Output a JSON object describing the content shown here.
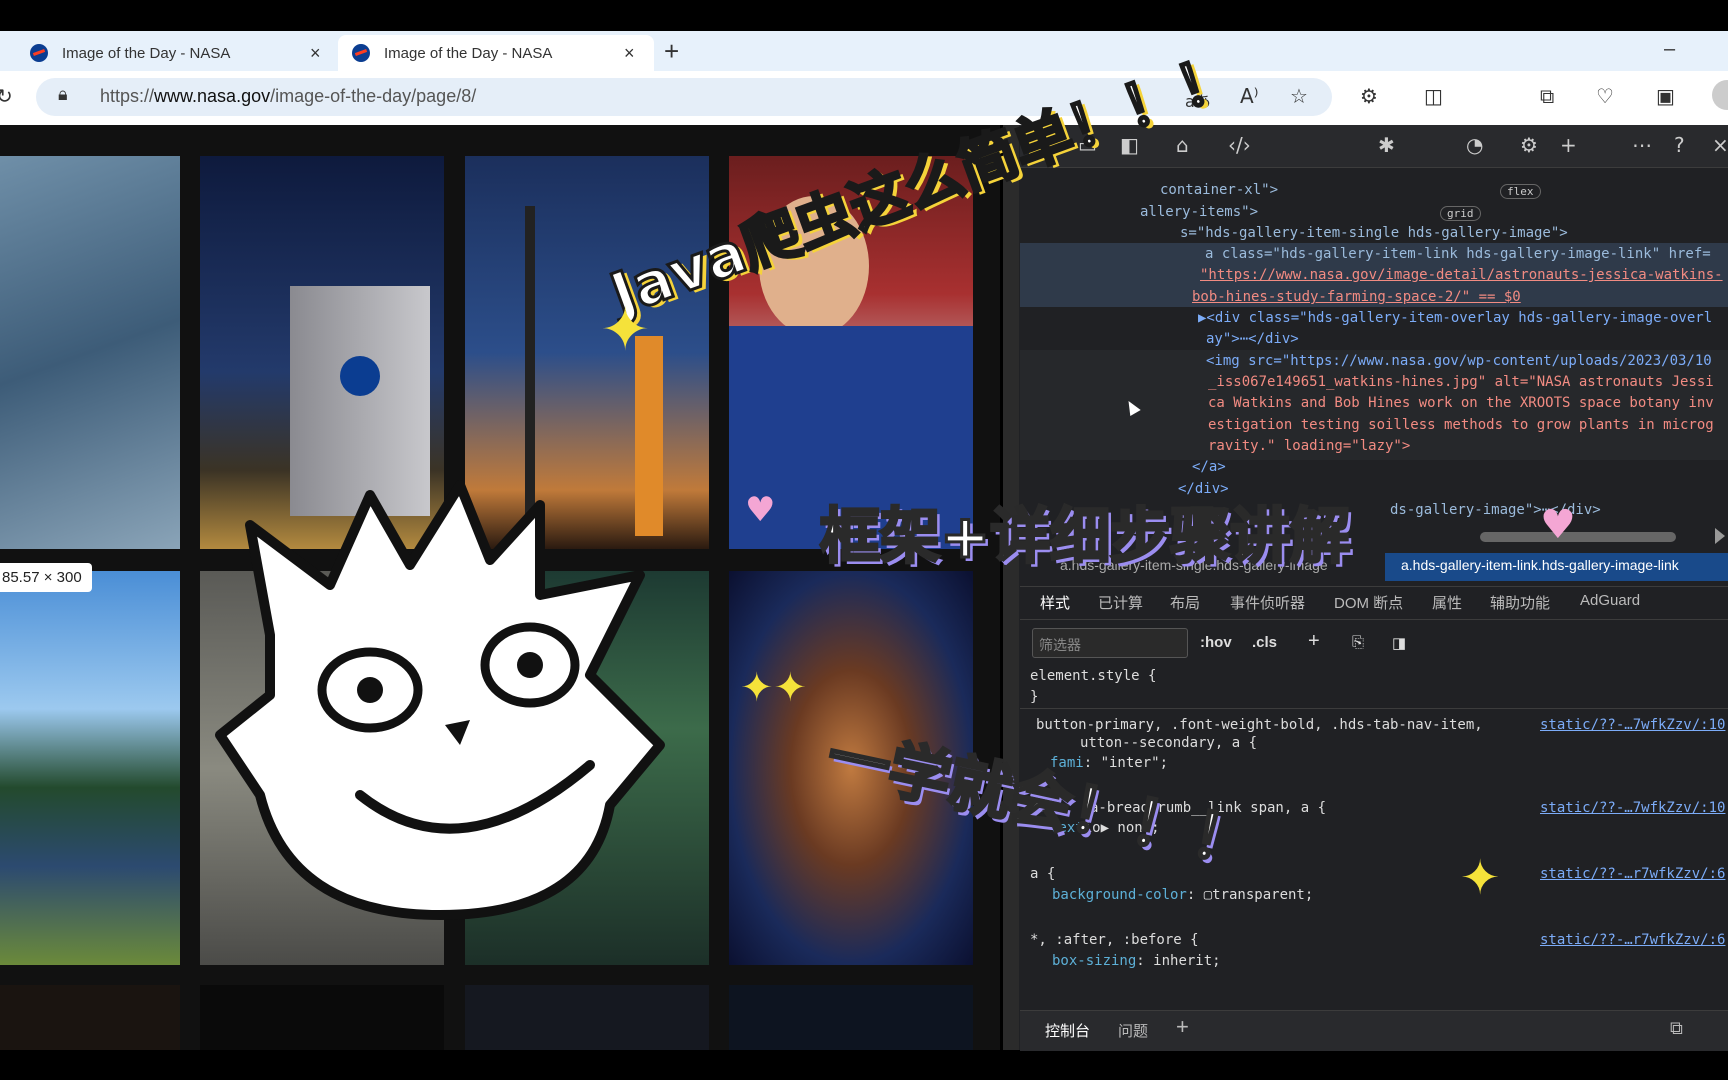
{
  "browser": {
    "tabs": [
      {
        "title": "Image of the Day - NASA",
        "close": "×"
      },
      {
        "title": "Image of the Day - NASA",
        "close": "×"
      }
    ],
    "new_tab": "+",
    "minimize": "–",
    "url_prefix": "https://",
    "url_host": "www.nasa.gov",
    "url_path": "/image-of-the-day/page/8/",
    "reader_label": "aあ",
    "read_aloud": "A⁾"
  },
  "gallery": {
    "tooltip": "85.57 × 300"
  },
  "devtools": {
    "dom_lines": [
      "container-xl\">",
      "allery-items\">",
      "s=\"hds-gallery-item-single hds-gallery-image\">",
      "a class=\"hds-gallery-item-link hds-gallery-image-link\" href=",
      "\"https://www.nasa.gov/image-detail/astronauts-jessica-watkins-",
      "bob-hines-study-farming-space-2/\" == $0",
      "▶<div class=\"hds-gallery-item-overlay hds-gallery-image-overl",
      "ay\">⋯</div>",
      "<img src=\"https://www.nasa.gov/wp-content/uploads/2023/03/10",
      "_iss067e149651_watkins-hines.jpg\" alt=\"NASA astronauts Jessi",
      "ca Watkins and Bob Hines work on the XROOTS space botany inv",
      "estigation testing soilless methods to grow plants in microg",
      "ravity.\" loading=\"lazy\">",
      "</a>",
      "</div>",
      "ds-gallery-image\">⋯</div>"
    ],
    "badge_flex": "flex",
    "badge_grid": "grid",
    "breadcrumb_prefix": "a.hds-gallery-item-single.hds-gallery-image",
    "breadcrumb_selected": "a.hds-gallery-item-link.hds-gallery-image-link",
    "style_tabs": [
      "样式",
      "已计算",
      "布局",
      "事件侦听器",
      "DOM 断点",
      "属性",
      "辅助功能",
      "AdGuard"
    ],
    "filter_placeholder": "筛选器",
    "hov": ":hov",
    "cls": ".cls",
    "rules": [
      {
        "selector": "element.style {",
        "body": "}",
        "src": ""
      },
      {
        "selector": "button-primary, .font-weight-bold, .hds-tab-nav-item,",
        "line2": "utton--secondary, a {",
        "prop": "fami",
        "value": ": \"inter\";",
        "src": "static/??-…7wfkZzv/:10"
      },
      {
        "selector": "a-breadcrumb__link span, a {",
        "prop": "text",
        "value": "io▶ none;",
        "src": "static/??-…7wfkZzv/:10"
      },
      {
        "selector": "a {",
        "prop": "background-color",
        "value": ": ▢transparent;",
        "src": "static/??-…r7wfkZzv/:6"
      },
      {
        "selector": "*, :after, :before {",
        "prop": "box-sizing",
        "value": ": inherit;",
        "src": "static/??-…r7wfkZzv/:6"
      }
    ],
    "console_tabs": [
      "控制台",
      "问题"
    ]
  },
  "overlay": {
    "headline": "Java爬虫这么简单！！！",
    "subtitle": "框架+详细步骤讲解",
    "tagline": "一学就会！！！"
  }
}
